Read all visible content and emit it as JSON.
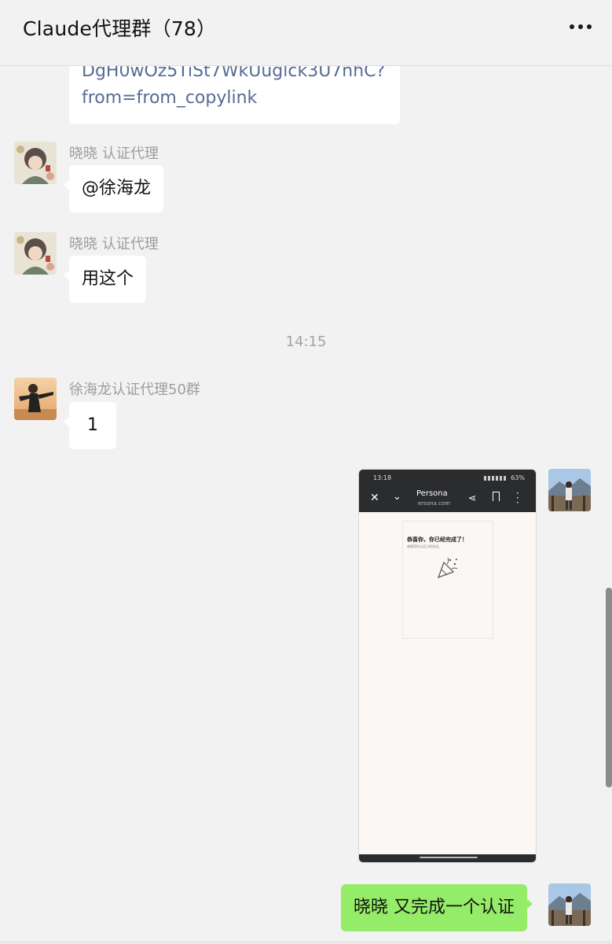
{
  "header": {
    "title": "Claude代理群（78）",
    "more_icon": "more-horizontal-icon"
  },
  "messages": [
    {
      "type": "link",
      "side": "left",
      "lines": [
        "DgH0wOz5TiSt7WkUuglck3U7nhC?",
        "from=from_copylink"
      ]
    },
    {
      "type": "text",
      "side": "left",
      "sender": "晓晓 认证代理",
      "text": "@徐海龙"
    },
    {
      "type": "text",
      "side": "left",
      "sender": "晓晓 认证代理",
      "text": "用这个"
    },
    {
      "type": "text",
      "side": "left",
      "sender": "徐海龙认证代理50群",
      "text": "1"
    },
    {
      "type": "image",
      "side": "right",
      "screenshot": {
        "status_time": "13:18",
        "battery": "63%",
        "site_title": "Persona",
        "domain": "ersona.com",
        "heading": "恭喜你，你已经完成了！",
        "subtext": "感谢您的认证已经发送。"
      }
    },
    {
      "type": "text",
      "side": "right",
      "text": "晓晓 又完成一个认证"
    }
  ],
  "timestamp": "14:15",
  "colors": {
    "background": "#f2f2f2",
    "bubble_left": "#ffffff",
    "bubble_right": "#95ec69",
    "link_text": "#576b95",
    "sender_text": "#9d9d9d"
  }
}
